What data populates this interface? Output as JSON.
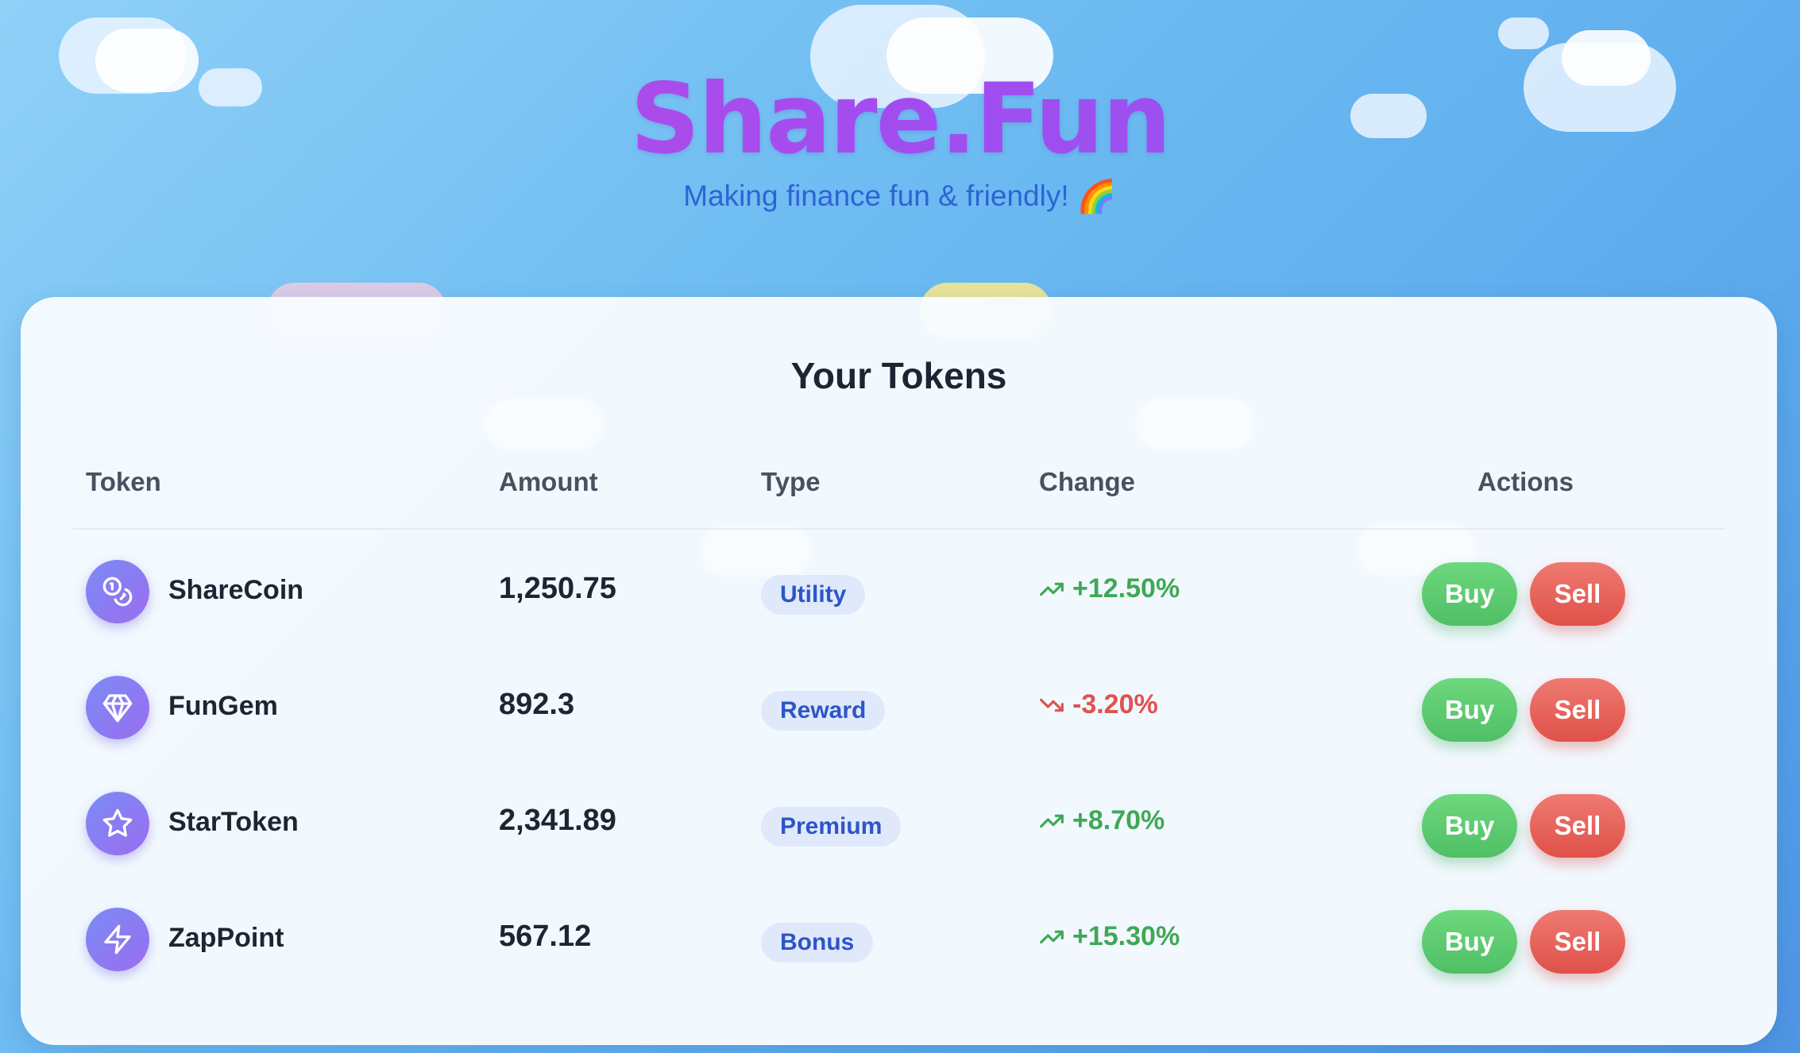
{
  "app": {
    "logo": "Share.Fun",
    "tagline": "Making finance fun & friendly!",
    "tagline_emoji": "🌈"
  },
  "card": {
    "title": "Your Tokens",
    "columns": [
      "Token",
      "Amount",
      "Type",
      "Change",
      "Actions"
    ]
  },
  "tokens": [
    {
      "name": "ShareCoin",
      "icon": "coins-icon",
      "amount": "1,250.75",
      "type": "Utility",
      "change": "+12.50%",
      "trend": "up",
      "buy": "Buy",
      "sell": "Sell"
    },
    {
      "name": "FunGem",
      "icon": "gem-icon",
      "amount": "892.3",
      "type": "Reward",
      "change": "-3.20%",
      "trend": "down",
      "buy": "Buy",
      "sell": "Sell"
    },
    {
      "name": "StarToken",
      "icon": "star-icon",
      "amount": "2,341.89",
      "type": "Premium",
      "change": "+8.70%",
      "trend": "up",
      "buy": "Buy",
      "sell": "Sell"
    },
    {
      "name": "ZapPoint",
      "icon": "zap-icon",
      "amount": "567.12",
      "type": "Bonus",
      "change": "+15.30%",
      "trend": "up",
      "buy": "Buy",
      "sell": "Sell"
    }
  ],
  "colors": {
    "accent": "#a24cf0",
    "up": "#3fa856",
    "down": "#e0524f",
    "buy": "#5cc96f",
    "sell": "#e45e55",
    "badge_bg": "#dfe9fb",
    "badge_text": "#2d55c8"
  }
}
